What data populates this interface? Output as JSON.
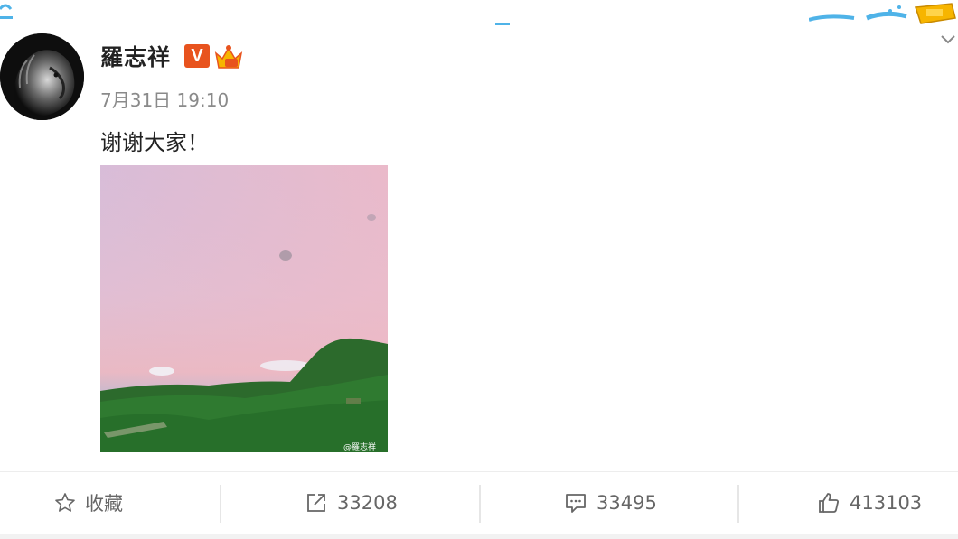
{
  "post": {
    "author": "羅志祥",
    "verified_badge": "V",
    "timestamp": "7月31日 19:10",
    "text": "谢谢大家！",
    "image_watermark": "@羅志祥"
  },
  "actions": {
    "favorite_label": "收藏",
    "share_count": "33208",
    "comment_count": "33495",
    "like_count": "413103"
  },
  "colors": {
    "badge_orange": "#e8531e",
    "crown_yellow": "#f7b500",
    "deco_blue": "#4fb3e8"
  },
  "icons": [
    "star-icon",
    "share-icon",
    "comment-icon",
    "like-icon",
    "chevron-down-icon",
    "crown-icon"
  ]
}
